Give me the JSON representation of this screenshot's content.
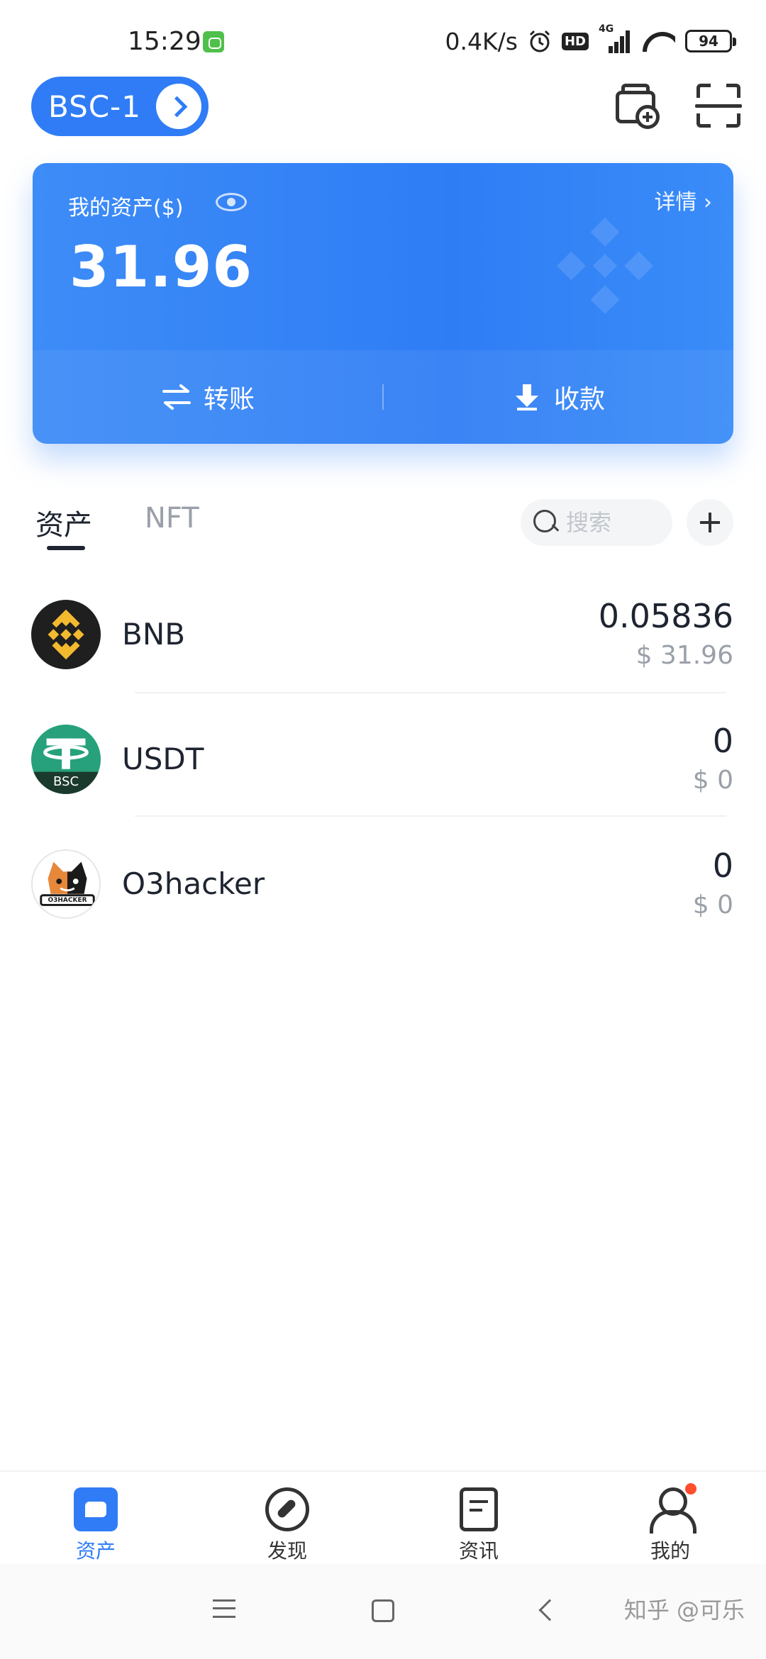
{
  "status_bar": {
    "time": "15:29",
    "net_speed": "0.4K/s",
    "hd_badge": "HD",
    "network_type": "4G",
    "battery": "94"
  },
  "header": {
    "network": "BSC-1",
    "icons": [
      "wallet-add-icon",
      "scan-icon"
    ]
  },
  "asset_card": {
    "label": "我的资产($)",
    "details_label": "详情 ›",
    "balance": "31.96",
    "transfer_label": "转账",
    "receive_label": "收款",
    "accent_color": "#2f7cf6"
  },
  "tabs": {
    "assets": "资产",
    "nft": "NFT",
    "active": "assets"
  },
  "search": {
    "placeholder": "搜索"
  },
  "tokens": [
    {
      "name": "BNB",
      "amount": "0.05836",
      "value": "$ 31.96",
      "logo": "bnb-logo"
    },
    {
      "name": "USDT",
      "amount": "0",
      "value": "$ 0",
      "logo": "usdt-bsc-logo",
      "logo_badge": "BSC"
    },
    {
      "name": "O3hacker",
      "amount": "0",
      "value": "$ 0",
      "logo": "o3hacker-logo",
      "logo_text": "O3HACKER"
    }
  ],
  "bottom_nav": {
    "items": [
      {
        "label": "资产",
        "icon": "wallet-icon",
        "active": true
      },
      {
        "label": "发现",
        "icon": "compass-icon",
        "active": false
      },
      {
        "label": "资讯",
        "icon": "news-icon",
        "active": false
      },
      {
        "label": "我的",
        "icon": "user-icon",
        "active": false,
        "has_notification": true
      }
    ]
  },
  "watermark": "知乎 @可乐"
}
